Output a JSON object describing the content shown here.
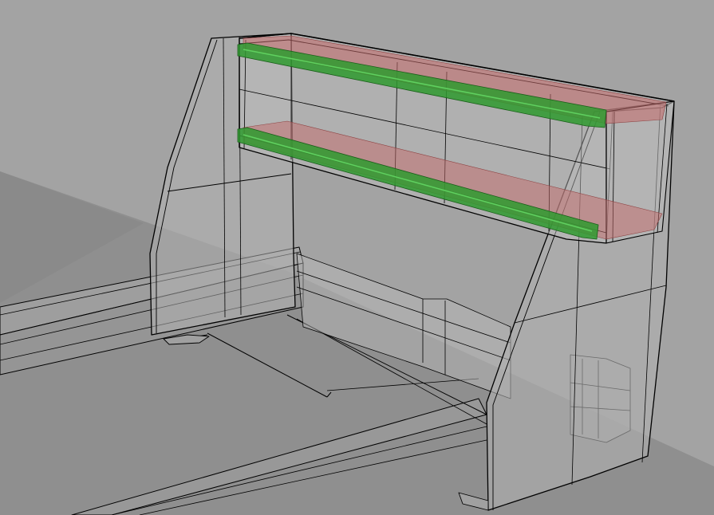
{
  "viewport": {
    "mode": "shaded-xray",
    "background_color": "#9c9c9c",
    "ground_color": "#8a8a8a",
    "ghost_fill_color": "#b4b4b4",
    "edge_color": "#000000"
  },
  "model": {
    "object": "cnc-router-frame",
    "highlighted_parts": [
      {
        "name": "linear-rail-upper",
        "color": "#2f9a2f"
      },
      {
        "name": "linear-rail-lower",
        "color": "#2f9a2f"
      },
      {
        "name": "rail-mount-plate-upper",
        "color": "#c46a6a"
      },
      {
        "name": "rail-mount-plate-lower",
        "color": "#c46a6a"
      }
    ]
  }
}
